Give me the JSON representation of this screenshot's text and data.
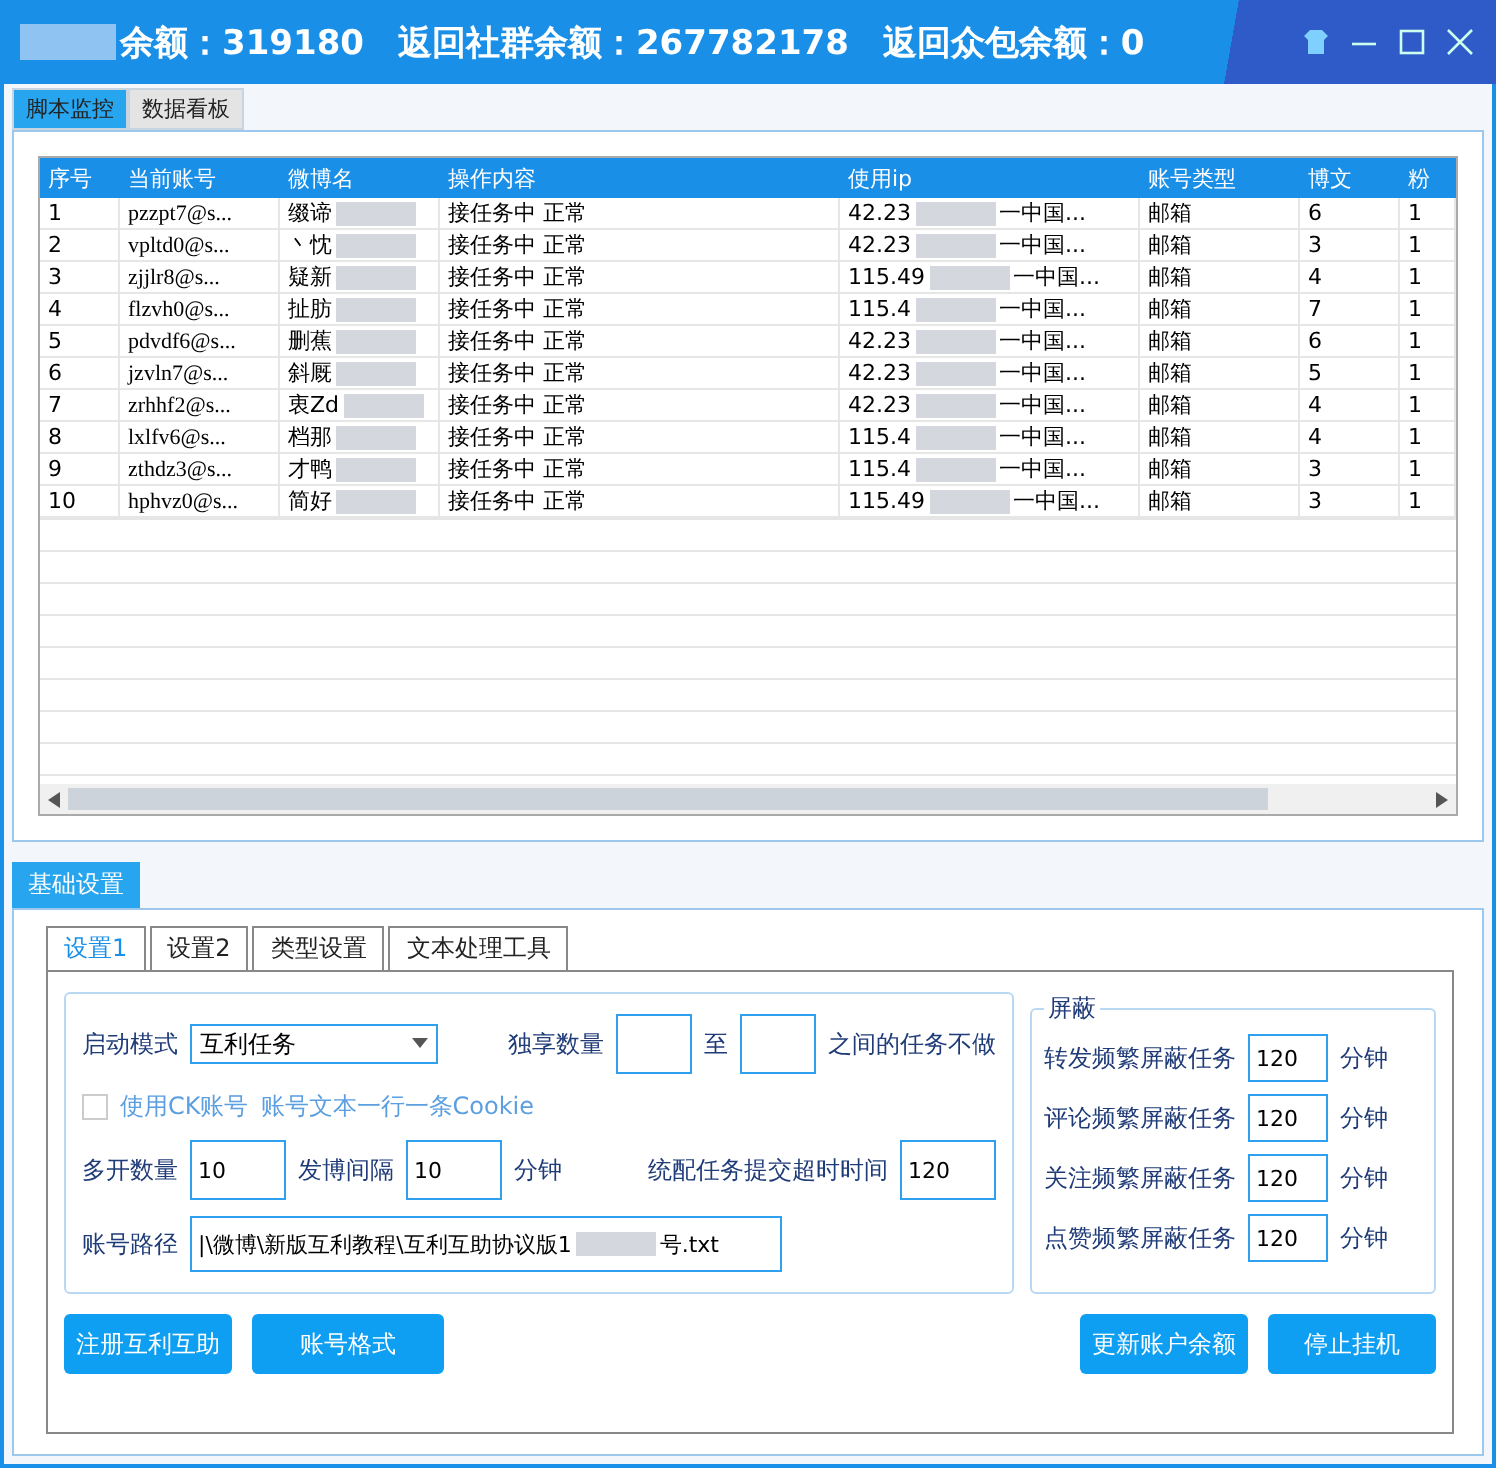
{
  "window": {
    "title": "余额：319180　返回社群余额：267782178　返回众包余额：0"
  },
  "top_tabs": [
    {
      "label": "脚本监控",
      "selected": true
    },
    {
      "label": "数据看板",
      "selected": false
    }
  ],
  "table": {
    "columns": [
      "序号",
      "当前账号",
      "微博名",
      "操作内容",
      "使用ip",
      "账号类型",
      "博文",
      "粉"
    ],
    "rows": [
      {
        "cells": [
          "1",
          "pzzpt7@s...",
          "缀谛",
          "接任务中 正常",
          [
            "42.23",
            "一中国..."
          ],
          "邮箱",
          "6",
          "1"
        ]
      },
      {
        "cells": [
          "2",
          "vpltd0@s...",
          "丶忱",
          "接任务中 正常",
          [
            "42.23",
            "一中国..."
          ],
          "邮箱",
          "3",
          "1"
        ]
      },
      {
        "cells": [
          "3",
          "zjjlr8@s...",
          "疑新",
          "接任务中 正常",
          [
            "115.49",
            "一中国..."
          ],
          "邮箱",
          "4",
          "1"
        ]
      },
      {
        "cells": [
          "4",
          "flzvh0@s...",
          "扯肪",
          "接任务中 正常",
          [
            "115.4",
            "一中国..."
          ],
          "邮箱",
          "7",
          "1"
        ]
      },
      {
        "cells": [
          "5",
          "pdvdf6@s...",
          "删蕉",
          "接任务中 正常",
          [
            "42.23",
            "一中国..."
          ],
          "邮箱",
          "6",
          "1"
        ]
      },
      {
        "cells": [
          "6",
          "jzvln7@s...",
          "斜厩",
          "接任务中 正常",
          [
            "42.23",
            "一中国..."
          ],
          "邮箱",
          "5",
          "1"
        ]
      },
      {
        "cells": [
          "7",
          "zrhhf2@s...",
          "衷Zd",
          "接任务中 正常",
          [
            "42.23",
            "一中国..."
          ],
          "邮箱",
          "4",
          "1"
        ]
      },
      {
        "cells": [
          "8",
          "lxlfv6@s...",
          "档那",
          "接任务中 正常",
          [
            "115.4",
            "一中国..."
          ],
          "邮箱",
          "4",
          "1"
        ]
      },
      {
        "cells": [
          "9",
          "zthdz3@s...",
          "才鸭",
          "接任务中 正常",
          [
            "115.4",
            "一中国..."
          ],
          "邮箱",
          "3",
          "1"
        ]
      },
      {
        "cells": [
          "10",
          "hphvz0@s...",
          "简好",
          "接任务中 正常",
          [
            "115.49",
            "一中国..."
          ],
          "邮箱",
          "3",
          "1"
        ]
      }
    ]
  },
  "settings_tab": "基础设置",
  "sub_tabs": [
    {
      "label": "设置1",
      "selected": true
    },
    {
      "label": "设置2",
      "selected": false
    },
    {
      "label": "类型设置",
      "selected": false
    },
    {
      "label": "文本处理工具",
      "selected": false
    }
  ],
  "form": {
    "start_mode_label": "启动模式",
    "start_mode_value": "互利任务",
    "exclusive_label": "独享数量",
    "to_label": "至",
    "exclusive_suffix": "之间的任务不做",
    "use_ck": {
      "label": "使用CK账号",
      "checked": false,
      "disabled": true
    },
    "ck_hint": "账号文本一行一条Cookie",
    "multi_label": "多开数量",
    "multi_value": "10",
    "interval_label": "发博间隔",
    "interval_value": "10",
    "interval_unit": "分钟",
    "timeout_label": "统配任务提交超时时间",
    "timeout_value": "120",
    "path_label": "账号路径",
    "path_value": "|\\微博\\新版互利教程\\互利互助协议版1",
    "path_tail": "号.txt"
  },
  "shield": {
    "title": "屏蔽",
    "rows": [
      {
        "label": "转发频繁屏蔽任务",
        "value": "120",
        "unit": "分钟"
      },
      {
        "label": "评论频繁屏蔽任务",
        "value": "120",
        "unit": "分钟"
      },
      {
        "label": "关注频繁屏蔽任务",
        "value": "120",
        "unit": "分钟"
      },
      {
        "label": "点赞频繁屏蔽任务",
        "value": "120",
        "unit": "分钟"
      }
    ]
  },
  "buttons_left": [
    "注册互利互助",
    "账号格式"
  ],
  "buttons_right": [
    "更新账户余额",
    "停止挂机"
  ]
}
